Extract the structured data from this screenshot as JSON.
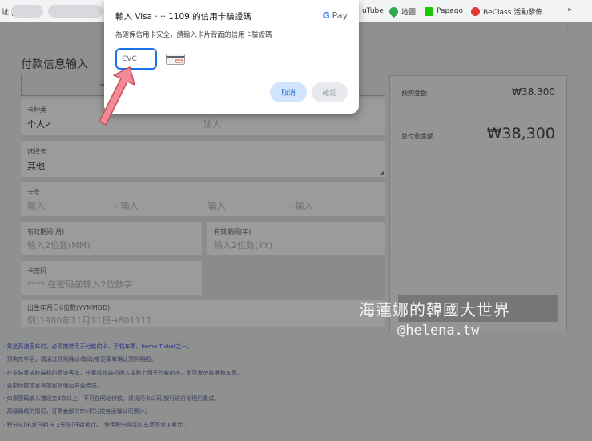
{
  "bookmarks": {
    "left_text": "址 | Г",
    "items": [
      {
        "label": "uTube",
        "color": "#ff0000"
      },
      {
        "label": "地圖",
        "color": "#34a853"
      },
      {
        "label": "Papago",
        "color": "#1ec800"
      },
      {
        "label": "BeClass 活動發佈...",
        "color": "#e53935"
      }
    ],
    "more": "»"
  },
  "page": {
    "section_title": "付款信息输入",
    "tab_middle": "+",
    "fields": {
      "card_type_label": "卡种类",
      "card_type_personal": "个人✓",
      "card_type_corporate": "法人",
      "select_card_label": "选择卡",
      "select_card_value": "其他",
      "card_number_label": "卡号",
      "card_number_ph1": "输入",
      "card_number_ph2": "- 输入",
      "card_number_ph3": "- 输入",
      "card_number_ph4": "- 输入",
      "exp_month_label": "有效期间(月)",
      "exp_month_ph": "输入2位数(MM)",
      "exp_year_label": "有效期间(年)",
      "exp_year_ph": "输入2位数(YY)",
      "password_label": "卡密码",
      "password_ph": "**** 在密码前输入2位数字",
      "birth_label": "出生年月日6位数(YYMMDD)",
      "birth_ph": "例)1980年11月11日→801111"
    },
    "summary": {
      "booking_label": "预购金额",
      "booking_value": "₩38.300",
      "total_label": "总付款金额",
      "total_value": "₩38,300"
    },
    "notes": [
      "· 乘坐高速客车时，必须携带用于付款的卡、手机车票、home Ticket之一。",
      "· 预购完毕后，请通过预购确认/取消/变更菜单确认预购明细。",
      "· 在安装集成终端机的高速客车，往集成终端机插入或贴上用于付款的卡，即可发放收据和车票。",
      "· 全部付款信息将加密处理后安全传送。",
      "· 如果密码输入错误变3次以上，不可在网站付款，请访问卡公司/银行进行处理后重试。",
      "· 高级路线的情况，订票金额的5%积分按各运输公司累计。",
      "· 积分从[出发日期 + 2天]时开始累计。（使用积分购买的车票不参加累计。）"
    ],
    "watermark_line1": "海蓮娜的韓國大世界",
    "watermark_line2": "@helena.tw"
  },
  "dialog": {
    "title": "輸入 Visa ‧‧‧‧ 1109 的信用卡驗證碼",
    "brand": "Pay",
    "subtitle": "為確保信用卡安全，請輸入卡片背面的信用卡驗證碼",
    "cvc_placeholder": "CVC",
    "cvc_value": "",
    "cancel_label": "取消",
    "confirm_label": "確認",
    "accent_color": "#1a73e8"
  }
}
